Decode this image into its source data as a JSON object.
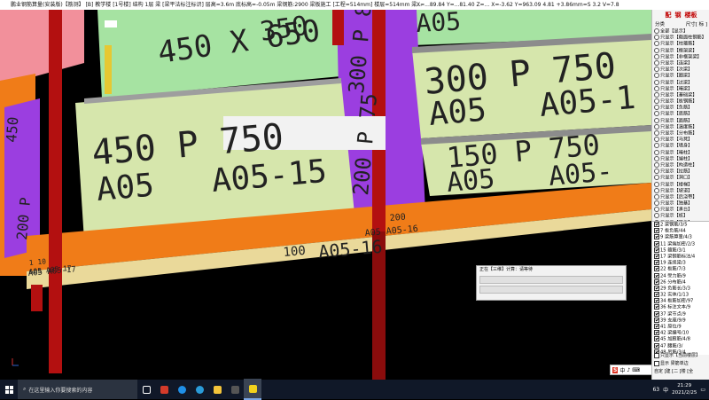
{
  "window": {
    "title": "鹏业钢筋算量(安装版)【筋测】 [B] 教学楼 [1号楼] 结构 1层 梁 [梁平法标注标识] 层高=3.6m 底标高=-0.05m 梁钢筋:2900 梁板施工 [工程=514mm] 楼层=514mm 梁...",
    "coords": "X=...89.84 Y=...81.40 Z=...  X=-3.62 Y=963.09 4.81 +3.86mm=S 3.2 V=7.8"
  },
  "canvas_labels": {
    "top_slab": "450 X 650",
    "top_slab_b": "350",
    "mid_slab_1": "450 P 750",
    "mid_slab_1b": "A05",
    "mid_slab_1c": "A05-15",
    "right_slab_1": "300 P 750",
    "right_slab_1b": "A05",
    "right_slab_1c": "A05-1",
    "right_slab_2": "150 P 750",
    "right_slab_2b": "A05",
    "right_slab_2c": "A05-",
    "right_top": "A05",
    "beam_text_1": "A05 A05-16",
    "beam_text_2": "200",
    "beam_text_3": "A05 A05-17",
    "beam_text_4": "A05-16",
    "beam_text_5": "100",
    "left_text_1": "450",
    "left_text_2": "200 P",
    "left_text_3": "1 10",
    "left_text_4": "A05 A05-17",
    "vert_text_1": "200 P 75",
    "vert_text_2": "300 P 80"
  },
  "panel": {
    "tabs": [
      "配",
      "钢",
      "楼板"
    ],
    "header_left": "分类",
    "header_right": "尺寸[ 标 ]",
    "tree": [
      "全部【显示】",
      "只显示【截面柱钢筋】",
      "只显示【柱箍筋】",
      "只显示【框架梁】",
      "只显示【非框架梁】",
      "只显示【连梁】",
      "只显示【次梁】",
      "只显示【圈梁】",
      "只显示【过梁】",
      "只显示【暗梁】",
      "只显示【基础梁】",
      "只显示【板钢筋】",
      "只显示【负筋】",
      "只显示【底筋】",
      "只显示【面筋】",
      "只显示【温度筋】",
      "只显示【分布筋】",
      "只显示【马凳】",
      "只显示【墙身】",
      "只显示【暗柱】",
      "只显示【端柱】",
      "只显示【构造柱】",
      "只显示【拉筋】",
      "只显示【洞口】",
      "只显示【楼梯】",
      "只显示【坡道】",
      "只显示【后浇带】",
      "只显示【独基】",
      "只显示【承台】",
      "只显示【桩】",
      "只显示【筏板】",
      "只显示【集水坑】"
    ],
    "layers": [
      {
        "label": "2 梁钢筋/3/5",
        "checked": true
      },
      {
        "label": "7 板负筋/44",
        "checked": true
      },
      {
        "label": "9 梁筋算量/4/3",
        "checked": true
      },
      {
        "label": "11 梁端加密/2/3",
        "checked": true
      },
      {
        "label": "15 箍筋/3/1",
        "checked": true
      },
      {
        "label": "17 梁钢筋标注/4",
        "checked": true
      },
      {
        "label": "19 连续梁/3",
        "checked": true
      },
      {
        "label": "22 板筋/7/3",
        "checked": true
      },
      {
        "label": "24 受力筋/9",
        "checked": true
      },
      {
        "label": "26 分布筋/4",
        "checked": true
      },
      {
        "label": "29 负筋长/3/3",
        "checked": true
      },
      {
        "label": "32 实体/1/13",
        "checked": true
      },
      {
        "label": "34 板筋加密/97",
        "checked": true
      },
      {
        "label": "36 标注文本/9",
        "checked": true
      },
      {
        "label": "37 梁节点/9",
        "checked": true
      },
      {
        "label": "39 支座/9/9",
        "checked": true
      },
      {
        "label": "41 原位/9",
        "checked": true
      },
      {
        "label": "42 梁编号/10",
        "checked": true
      },
      {
        "label": "45 加腋筋/4/8",
        "checked": true
      },
      {
        "label": "47 腰筋/3/",
        "checked": true
      },
      {
        "label": "48 吊筋/3/4",
        "checked": true
      },
      {
        "label": "50 拉筋/3/8",
        "checked": true
      },
      {
        "label": "52 附加筋/",
        "checked": true
      },
      {
        "label": "55 梁跨/4/9",
        "checked": true
      },
      {
        "label": "56 其他/4/5",
        "checked": true
      }
    ],
    "bottom_opt": "只显示【当前楼层】",
    "bottom_opt2": "显示 梁筋单边",
    "combo": "自定 [建 [二 [楼 [全"
  },
  "progress": {
    "title": "正在【三维】计算：请等待"
  },
  "taskbar": {
    "search_placeholder": "在这里输入你要搜索的内容",
    "time": "21:29",
    "date": "2021/2/25",
    "lang": "中",
    "tray_text": "63"
  },
  "colors": {
    "slab_green": "#a6e3a2",
    "slab_cream": "#d6e6ac",
    "beam_orange": "#f07c18",
    "beam_purple": "#9b3ee0",
    "column_red": "#b31010",
    "wall_pink": "#f2909b"
  }
}
